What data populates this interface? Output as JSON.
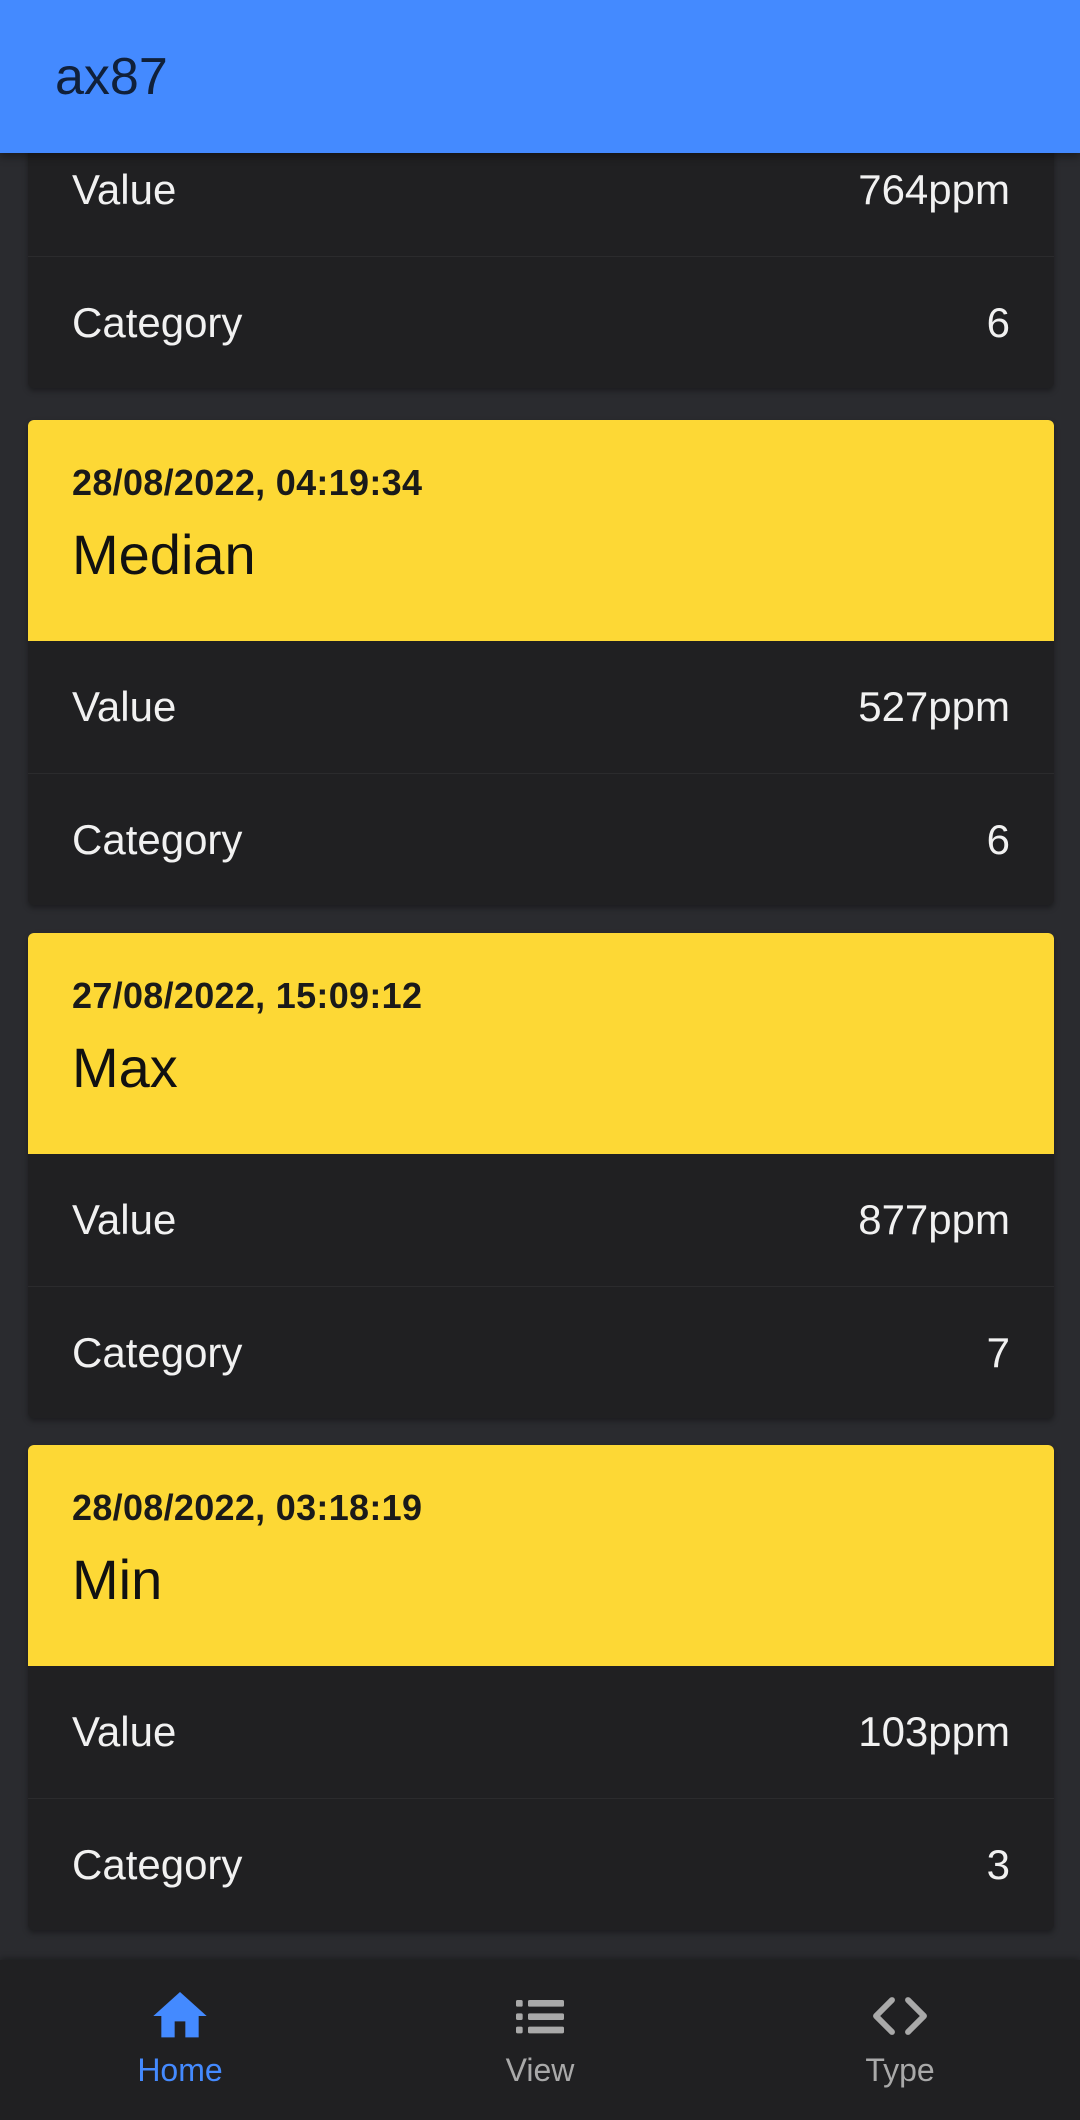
{
  "app": {
    "title": "ax87"
  },
  "cards": [
    {
      "rows": [
        {
          "label": "Value",
          "value": "764ppm"
        },
        {
          "label": "Category",
          "value": "6"
        }
      ]
    },
    {
      "date": "28/08/2022, 04:19:34",
      "name": "Median",
      "rows": [
        {
          "label": "Value",
          "value": "527ppm"
        },
        {
          "label": "Category",
          "value": "6"
        }
      ]
    },
    {
      "date": "27/08/2022, 15:09:12",
      "name": "Max",
      "rows": [
        {
          "label": "Value",
          "value": "877ppm"
        },
        {
          "label": "Category",
          "value": "7"
        }
      ]
    },
    {
      "date": "28/08/2022, 03:18:19",
      "name": "Min",
      "rows": [
        {
          "label": "Value",
          "value": "103ppm"
        },
        {
          "label": "Category",
          "value": "3"
        }
      ]
    }
  ],
  "nav": {
    "items": [
      {
        "label": "Home",
        "icon": "home-icon",
        "active": true
      },
      {
        "label": "View",
        "icon": "list-icon",
        "active": false
      },
      {
        "label": "Type",
        "icon": "code-icon",
        "active": false
      }
    ]
  },
  "colors": {
    "app_bar": "#448aff",
    "card_header": "#fdd835",
    "card_body": "#202022",
    "background": "#2a2b2f",
    "nav_active": "#448aff",
    "nav_inactive": "#a9a9a9"
  }
}
